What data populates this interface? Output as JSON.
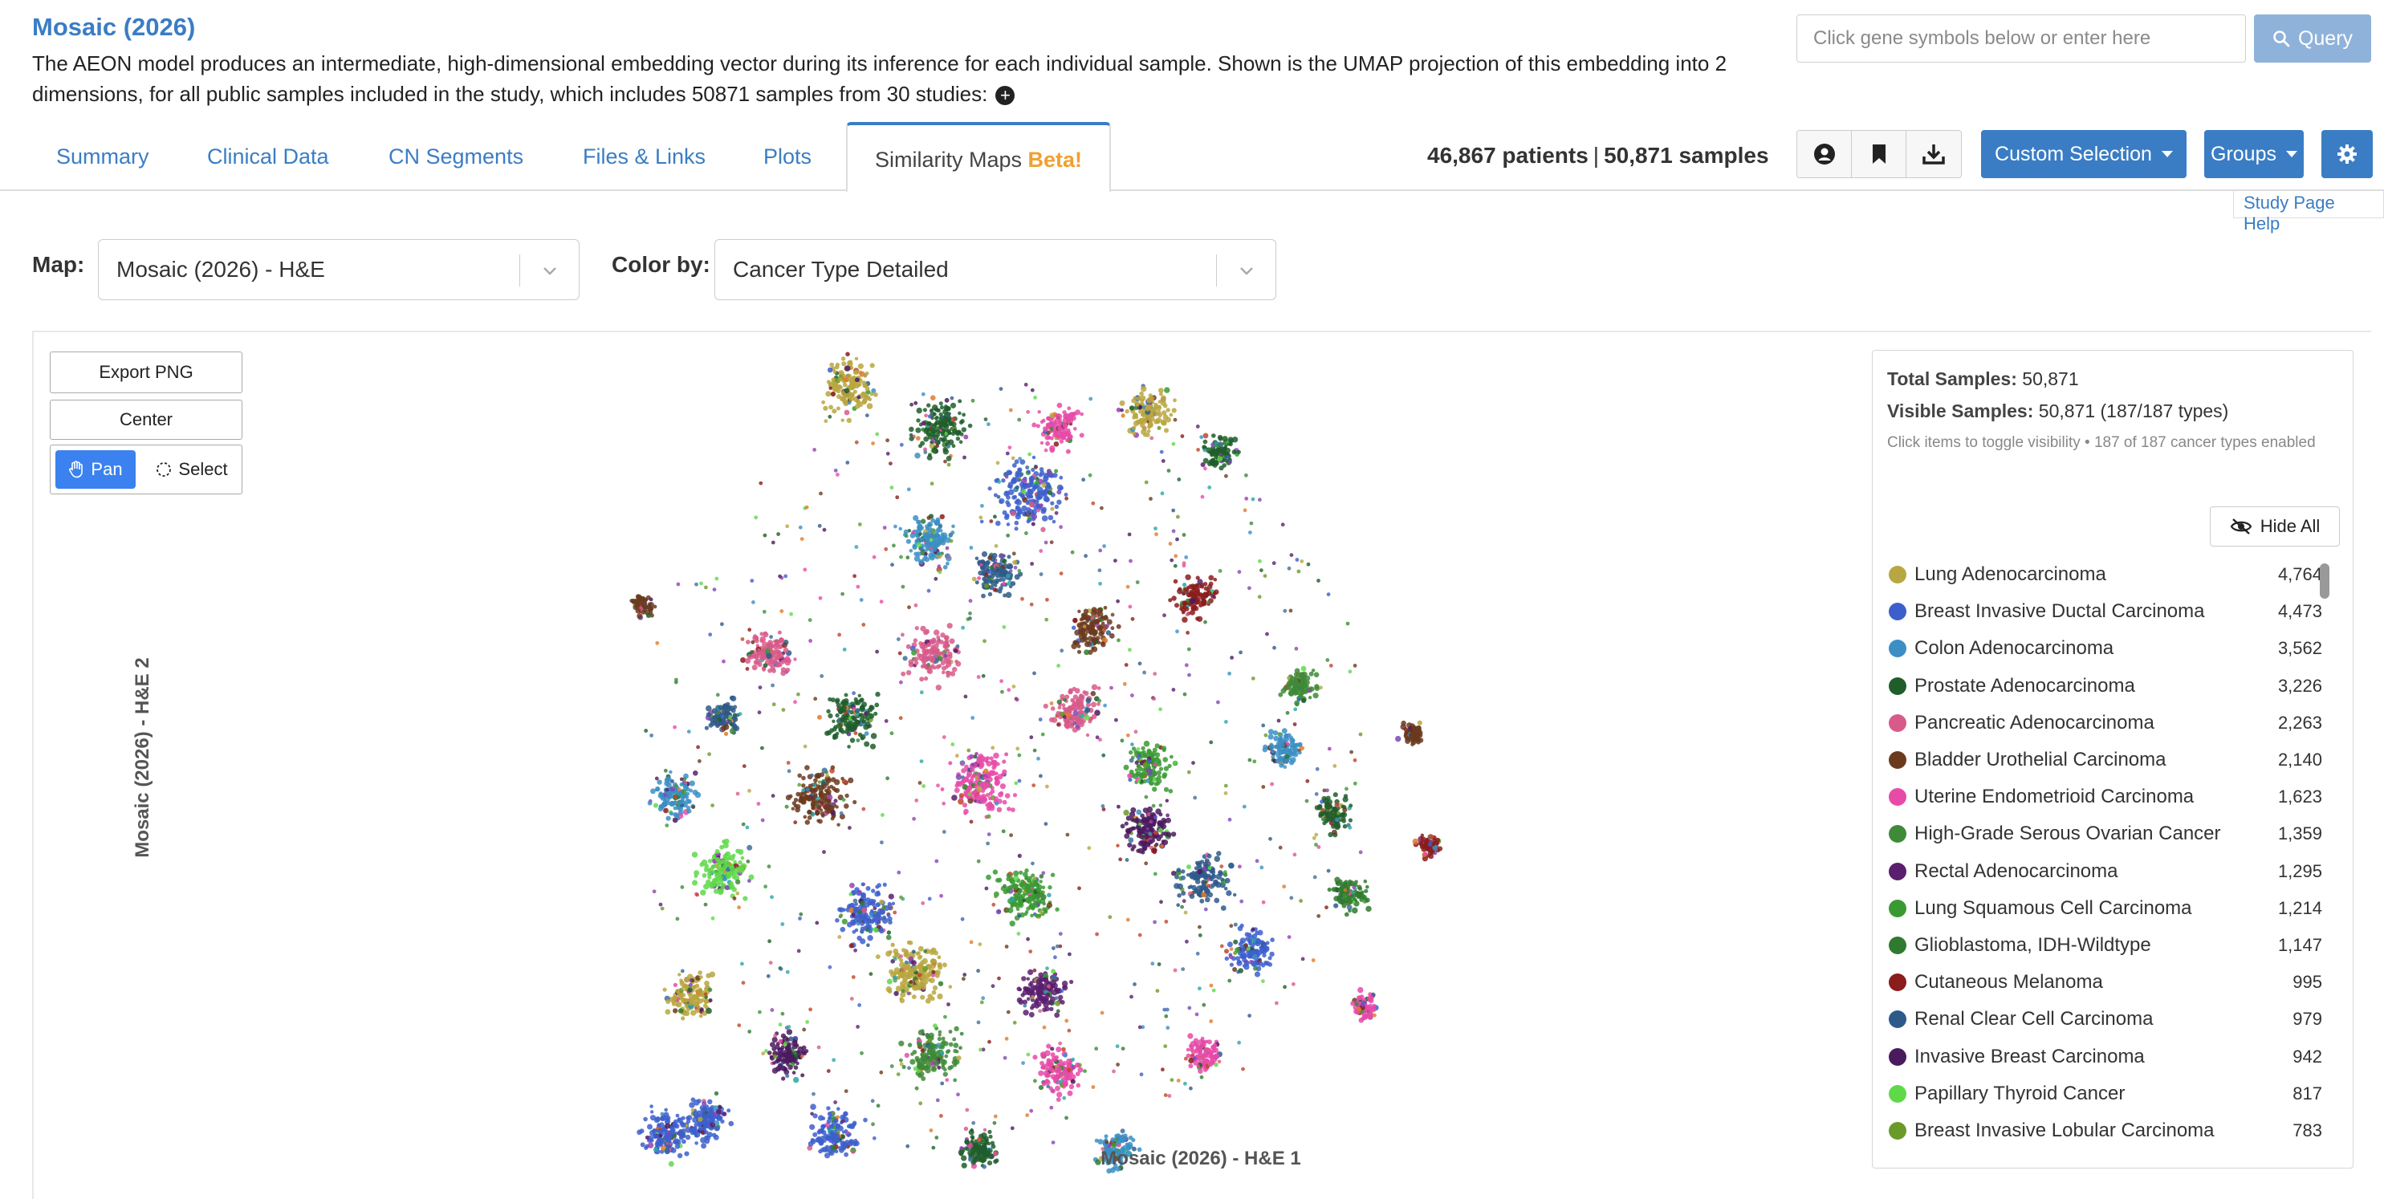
{
  "header": {
    "title": "Mosaic (2026)",
    "description": "The AEON model produces an intermediate, high-dimensional embedding vector during its inference for each individual sample. Shown is the UMAP projection of this embedding into 2 dimensions, for all public samples included in the study, which includes 50871 samples from 30 studies:",
    "expand_icon": "plus-circle-icon"
  },
  "search": {
    "placeholder": "Click gene symbols below or enter here",
    "query_label": "Query"
  },
  "tabs": [
    {
      "label": "Summary"
    },
    {
      "label": "Clinical Data"
    },
    {
      "label": "CN Segments"
    },
    {
      "label": "Files & Links"
    },
    {
      "label": "Plots"
    },
    {
      "label": "Similarity Maps",
      "badge": "Beta!",
      "active": true
    }
  ],
  "counts": {
    "patients": "46,867 patients",
    "separator": "|",
    "samples": "50,871 samples"
  },
  "toolbar": {
    "icons": [
      "user-circle-icon",
      "bookmark-icon",
      "download-icon"
    ],
    "custom_selection_label": "Custom Selection",
    "groups_label": "Groups",
    "settings_icon": "gear-icon",
    "help_label": "Study Page Help"
  },
  "controls": {
    "map_label": "Map:",
    "map_value": "Mosaic (2026) - H&E",
    "color_label": "Color by:",
    "color_value": "Cancer Type Detailed"
  },
  "plot": {
    "export_label": "Export PNG",
    "center_label": "Center",
    "pan_label": "Pan",
    "select_label": "Select",
    "xlabel": "Mosaic (2026) - H&E 1",
    "ylabel": "Mosaic (2026) - H&E 2"
  },
  "legend": {
    "total_label": "Total Samples:",
    "total_value": "50,871",
    "visible_label": "Visible Samples:",
    "visible_value": "50,871 (187/187 types)",
    "hint": "Click items to toggle visibility • 187 of 187 cancer types enabled",
    "hide_all_label": "Hide All",
    "items": [
      {
        "name": "Lung Adenocarcinoma",
        "count": "4,764",
        "color": "#b8a640"
      },
      {
        "name": "Breast Invasive Ductal Carcinoma",
        "count": "4,473",
        "color": "#3d5fcc"
      },
      {
        "name": "Colon Adenocarcinoma",
        "count": "3,562",
        "color": "#3b8fc4"
      },
      {
        "name": "Prostate Adenocarcinoma",
        "count": "3,226",
        "color": "#1f5e2b"
      },
      {
        "name": "Pancreatic Adenocarcinoma",
        "count": "2,263",
        "color": "#d85a8a"
      },
      {
        "name": "Bladder Urothelial Carcinoma",
        "count": "2,140",
        "color": "#6b3a1e"
      },
      {
        "name": "Uterine Endometrioid Carcinoma",
        "count": "1,623",
        "color": "#e84aa8"
      },
      {
        "name": "High-Grade Serous Ovarian Cancer",
        "count": "1,359",
        "color": "#3e8a38"
      },
      {
        "name": "Rectal Adenocarcinoma",
        "count": "1,295",
        "color": "#5a1f6e"
      },
      {
        "name": "Lung Squamous Cell Carcinoma",
        "count": "1,214",
        "color": "#3a9a32"
      },
      {
        "name": "Glioblastoma, IDH-Wildtype",
        "count": "1,147",
        "color": "#2f7a2f"
      },
      {
        "name": "Cutaneous Melanoma",
        "count": "995",
        "color": "#8a1c1c"
      },
      {
        "name": "Renal Clear Cell Carcinoma",
        "count": "979",
        "color": "#2e5a8a"
      },
      {
        "name": "Invasive Breast Carcinoma",
        "count": "942",
        "color": "#4a1a5e"
      },
      {
        "name": "Papillary Thyroid Cancer",
        "count": "817",
        "color": "#5fd84a"
      },
      {
        "name": "Breast Invasive Lobular Carcinoma",
        "count": "783",
        "color": "#6a9a2a"
      }
    ]
  }
}
